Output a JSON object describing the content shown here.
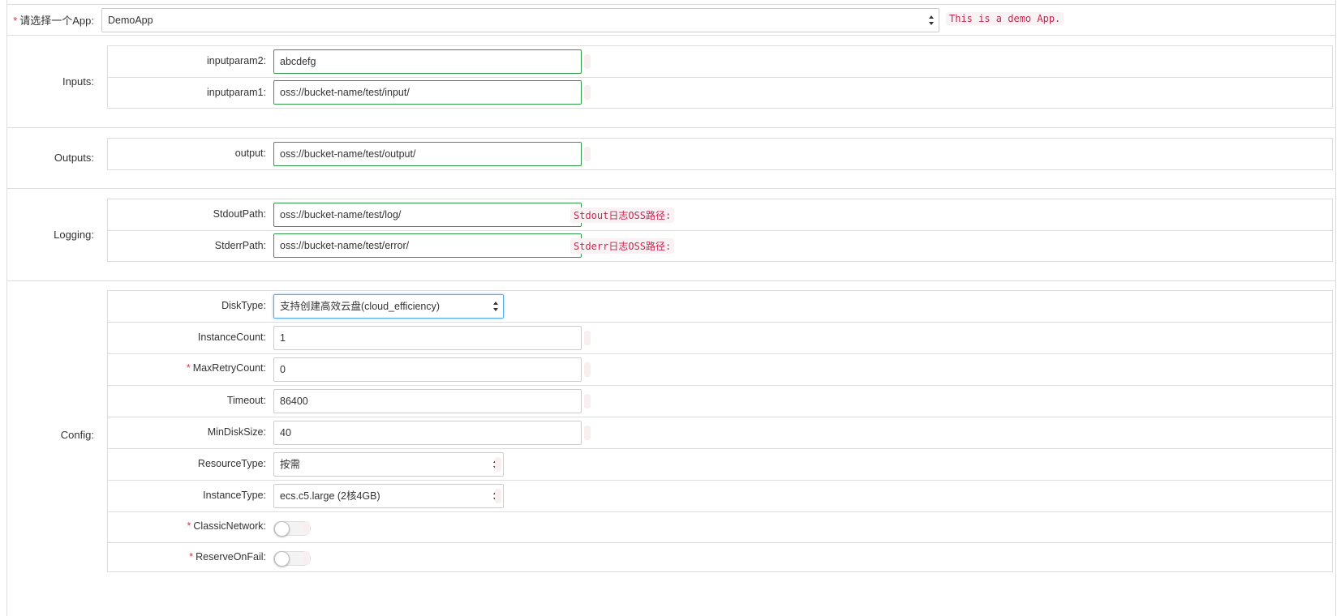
{
  "app": {
    "label": "请选择一个App:",
    "selected": "DemoApp",
    "hint": "This is a demo App."
  },
  "inputs": {
    "label": "Inputs:",
    "rows": [
      {
        "label": "inputparam2:",
        "value": "abcdefg"
      },
      {
        "label": "inputparam1:",
        "value": "oss://bucket-name/test/input/"
      }
    ]
  },
  "outputs": {
    "label": "Outputs:",
    "rows": [
      {
        "label": "output:",
        "value": "oss://bucket-name/test/output/"
      }
    ]
  },
  "logging": {
    "label": "Logging:",
    "rows": [
      {
        "label": "StdoutPath:",
        "value": "oss://bucket-name/test/log/",
        "hint": "Stdout日志OSS路径:"
      },
      {
        "label": "StderrPath:",
        "value": "oss://bucket-name/test/error/",
        "hint": "Stderr日志OSS路径:"
      }
    ]
  },
  "config": {
    "label": "Config:",
    "disk_type": {
      "label": "DiskType:",
      "value": "支持创建高效云盘(cloud_efficiency)"
    },
    "instance_count": {
      "label": "InstanceCount:",
      "value": "1"
    },
    "max_retry_count": {
      "label": "MaxRetryCount:",
      "value": "0"
    },
    "timeout": {
      "label": "Timeout:",
      "value": "86400"
    },
    "min_disk_size": {
      "label": "MinDiskSize:",
      "value": "40"
    },
    "resource_type": {
      "label": "ResourceType:",
      "value": "按需"
    },
    "instance_type": {
      "label": "InstanceType:",
      "value": "ecs.c5.large (2核4GB)"
    },
    "classic_network": {
      "label": "ClassicNetwork:",
      "on": false
    },
    "reserve_on_fail": {
      "label": "ReserveOnFail:",
      "on": false
    }
  },
  "colors": {
    "valid_border": "#2e9c48",
    "required_mark": "#d9333f",
    "hint_text": "#c7254e"
  }
}
